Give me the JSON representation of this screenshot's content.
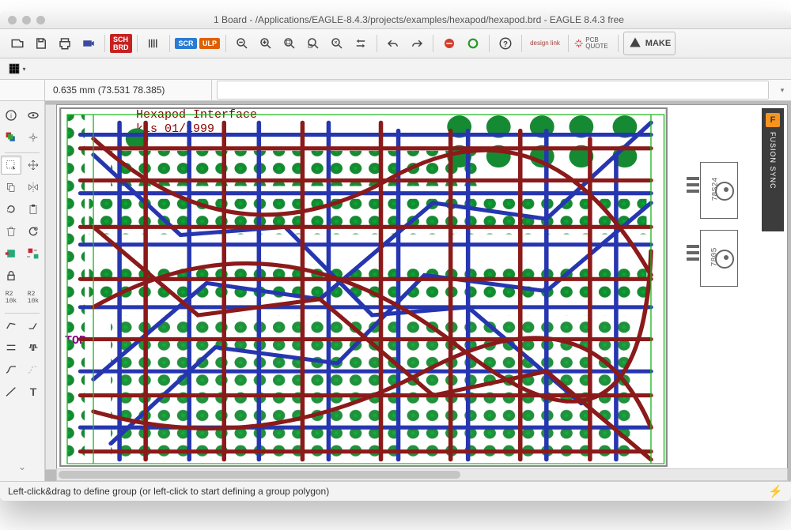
{
  "window": {
    "title": "1 Board - /Applications/EAGLE-8.4.3/projects/examples/hexapod/hexapod.brd - EAGLE 8.4.3 free"
  },
  "toolbar": {
    "sch_label": "SCH\nBRD",
    "scr_label": "SCR",
    "ulp_label": "ULP",
    "design_link": "design\nlink",
    "pcb_quote": "PCB\nQUOTE",
    "make": "MAKE"
  },
  "coord": "0.635 mm (73.531 78.385)",
  "cmd_placeholder": "",
  "board": {
    "title_line1": "Hexapod Interface",
    "title_line2": "kls 01/1999",
    "layer_label": "TOP",
    "components": {
      "reg1": "78S24",
      "reg2": "7805"
    }
  },
  "sidepanel": {
    "label": "FUSION SYNC",
    "icon_letter": "F"
  },
  "status": "Left-click&drag to define group (or left-click to start defining a group polygon)"
}
